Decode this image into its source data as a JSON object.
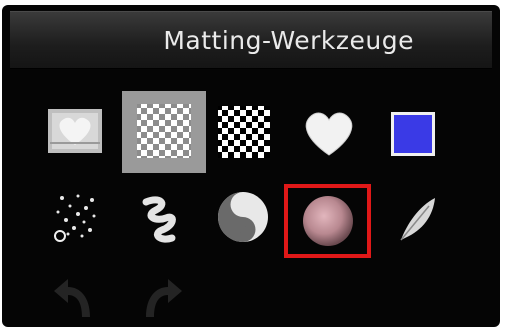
{
  "panel": {
    "title": "Matting-Werkzeuge"
  },
  "tools": [
    {
      "name": "heart-photo-icon"
    },
    {
      "name": "transparency-checker-selected-icon",
      "state": "active"
    },
    {
      "name": "transparency-checker-icon"
    },
    {
      "name": "white-heart-icon"
    },
    {
      "name": "blue-color-swatch-icon",
      "color": "#3a3ae6"
    },
    {
      "name": "scatter-dots-brush-icon"
    },
    {
      "name": "squiggle-brush-icon"
    },
    {
      "name": "yin-yang-icon"
    },
    {
      "name": "pink-sphere-icon",
      "state": "highlighted",
      "highlight_color": "#e01818"
    },
    {
      "name": "feather-icon"
    },
    {
      "name": "undo-arrow-icon",
      "state": "disabled"
    },
    {
      "name": "redo-arrow-icon",
      "state": "disabled"
    }
  ]
}
